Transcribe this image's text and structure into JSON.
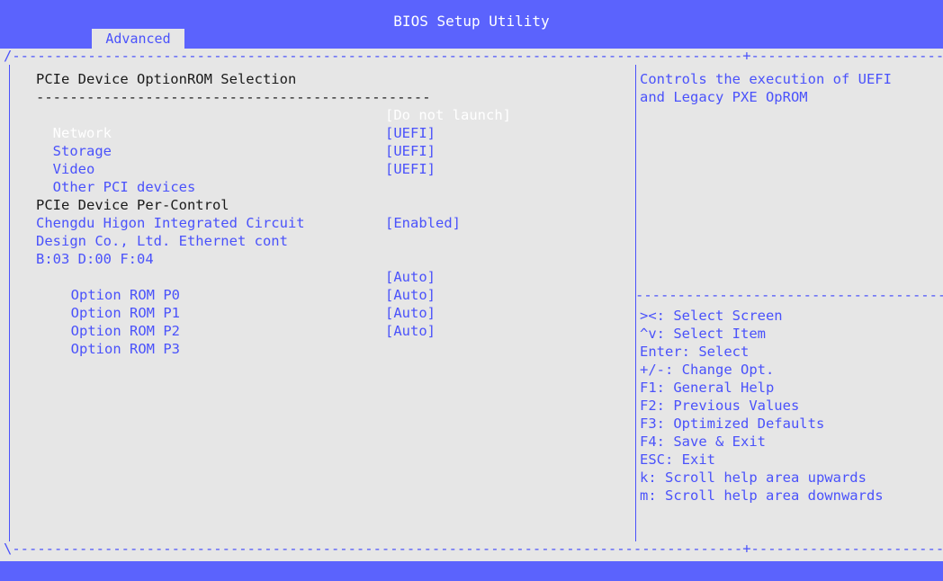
{
  "header": {
    "title": "BIOS Setup Utility",
    "active_tab": "Advanced"
  },
  "left": {
    "section1_title": "PCIe Device OptionROM Selection",
    "separator": "-----------------------------------------------",
    "network": {
      "label": "Network",
      "value": "[Do not launch]"
    },
    "storage": {
      "label": "Storage",
      "value": "[UEFI]"
    },
    "video": {
      "label": "Video",
      "value": "[UEFI]"
    },
    "other": {
      "label": "Other PCI devices",
      "value": "[UEFI]"
    },
    "section2_title": "PCIe Device Per-Control",
    "device": {
      "line1": "Chengdu Higon Integrated Circuit",
      "line2": "Design Co., Ltd. Ethernet cont",
      "line3": "B:03 D:00 F:04",
      "value": "[Enabled]"
    },
    "roms": [
      {
        "label": "Option ROM P0",
        "value": "[Auto]"
      },
      {
        "label": "Option ROM P1",
        "value": "[Auto]"
      },
      {
        "label": "Option ROM P2",
        "value": "[Auto]"
      },
      {
        "label": "Option ROM P3",
        "value": "[Auto]"
      }
    ]
  },
  "help": {
    "description_line1": "Controls the execution of UEFI",
    "description_line2": "and Legacy PXE OpROM",
    "keys": [
      "><: Select Screen",
      "^v: Select Item",
      "Enter: Select",
      "+/-: Change Opt.",
      "F1: General Help",
      "F2: Previous Values",
      "F3: Optimized Defaults",
      "F4: Save & Exit",
      "ESC: Exit",
      "k: Scroll help area upwards",
      "m: Scroll help area downwards"
    ]
  },
  "colors": {
    "bar_blue": "#5b63fd",
    "text_blue": "#4a52fb",
    "background": "#e6e6e6",
    "highlight": "#ffffff",
    "dark_text": "#1a1a1a"
  }
}
